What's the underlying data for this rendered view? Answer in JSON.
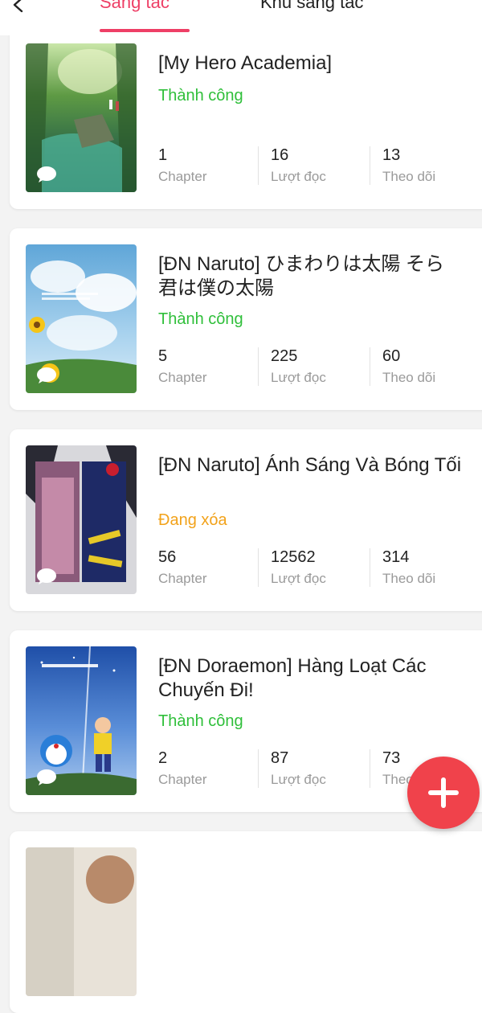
{
  "header": {
    "tabs": [
      {
        "label": "Sáng tác",
        "active": true
      },
      {
        "label": "Khu sáng tác",
        "active": false
      }
    ]
  },
  "colors": {
    "accent": "#ee3f66",
    "success": "#2fbf3a",
    "pending": "#f2a21a",
    "fab": "#f0424b"
  },
  "stories": [
    {
      "title": "[My Hero Academia]",
      "status": "Thành công",
      "status_type": "success",
      "chapters": "1",
      "chapters_label": "Chapter",
      "reads": "16",
      "reads_label": "Lượt đọc",
      "follows": "13",
      "follows_label": "Theo dõi"
    },
    {
      "title": "[ĐN Naruto] ひまわりは太陽 そら君は僕の太陽",
      "status": "Thành công",
      "status_type": "success",
      "chapters": "5",
      "chapters_label": "Chapter",
      "reads": "225",
      "reads_label": "Lượt đọc",
      "follows": "60",
      "follows_label": "Theo dõi"
    },
    {
      "title": "[ĐN Naruto] Ánh Sáng Và Bóng Tối",
      "status": "Đang xóa",
      "status_type": "pending",
      "chapters": "56",
      "chapters_label": "Chapter",
      "reads": "12562",
      "reads_label": "Lượt đọc",
      "follows": "314",
      "follows_label": "Theo dõi"
    },
    {
      "title": "[ĐN Doraemon] Hàng Loạt Các Chuyến Đi!",
      "status": "Thành công",
      "status_type": "success",
      "chapters": "2",
      "chapters_label": "Chapter",
      "reads": "87",
      "reads_label": "Lượt đọc",
      "follows": "73",
      "follows_label": "Theo dõi"
    }
  ],
  "icons": {
    "back": "chevron-left-icon",
    "comment": "comment-bubble-icon",
    "add": "plus-icon"
  }
}
